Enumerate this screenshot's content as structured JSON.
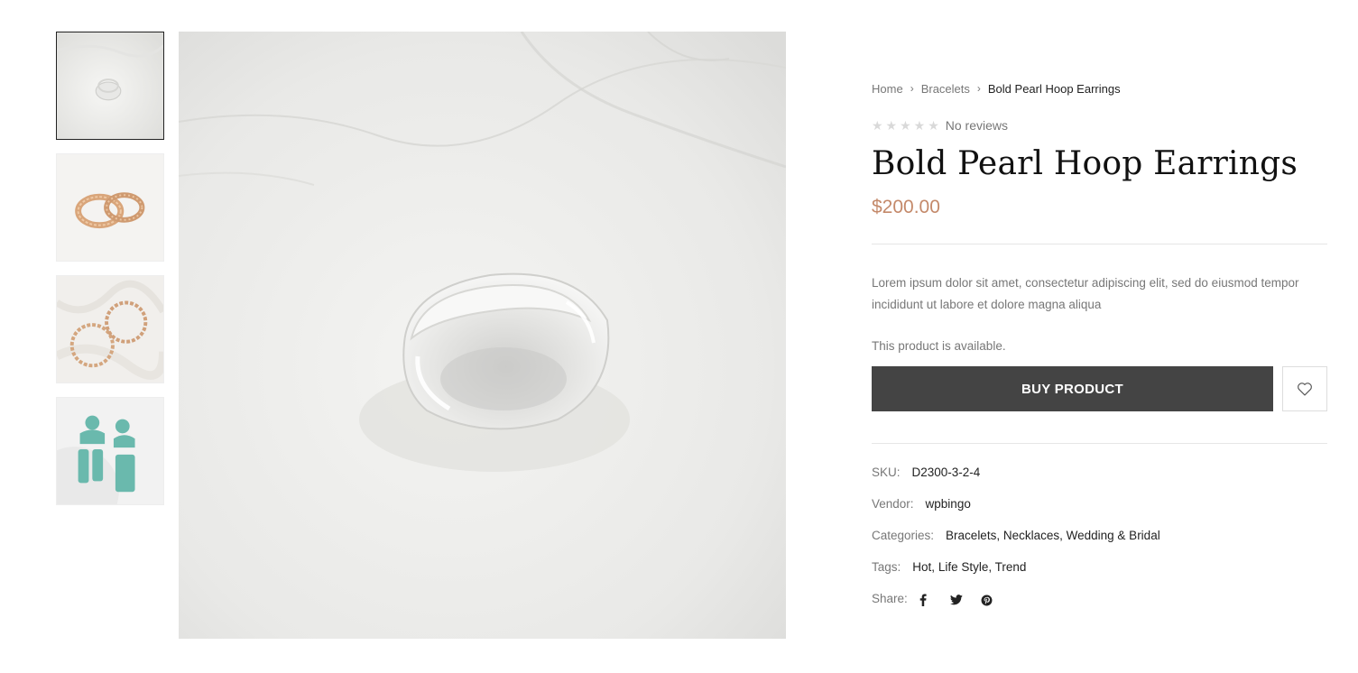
{
  "thumbnails": [
    {
      "alt": "clear-resin-ring",
      "active": true
    },
    {
      "alt": "gold-rings",
      "active": false
    },
    {
      "alt": "gold-hoop-earrings",
      "active": false
    },
    {
      "alt": "turquoise-earrings",
      "active": false
    }
  ],
  "breadcrumb": {
    "home": "Home",
    "category": "Bracelets",
    "current": "Bold Pearl Hoop Earrings",
    "separator": "›"
  },
  "reviews": {
    "stars": "★★★★★",
    "label": "No reviews"
  },
  "product": {
    "title": "Bold Pearl Hoop Earrings",
    "price": "$200.00",
    "description": "Lorem ipsum dolor sit amet, consectetur adipiscing elit, sed do eiusmod tempor incididunt ut labore et dolore magna aliqua",
    "availability": "This product is available."
  },
  "actions": {
    "buy_label": "BUY PRODUCT",
    "wishlist_icon": "heart-icon"
  },
  "meta": {
    "sku_label": "SKU:",
    "sku": "D2300-3-2-4",
    "vendor_label": "Vendor:",
    "vendor": "wpbingo",
    "categories_label": "Categories:",
    "categories": [
      "Bracelets",
      "Necklaces",
      "Wedding & Bridal"
    ],
    "tags_label": "Tags:",
    "tags": [
      "Hot",
      "Life Style",
      "Trend"
    ],
    "share_label": "Share:",
    "share_icons": [
      "facebook-icon",
      "twitter-icon",
      "pinterest-icon"
    ]
  },
  "colors": {
    "price": "#c4896a",
    "button_bg": "#444444",
    "muted_text": "#777777",
    "divider": "#e6e6e6"
  }
}
